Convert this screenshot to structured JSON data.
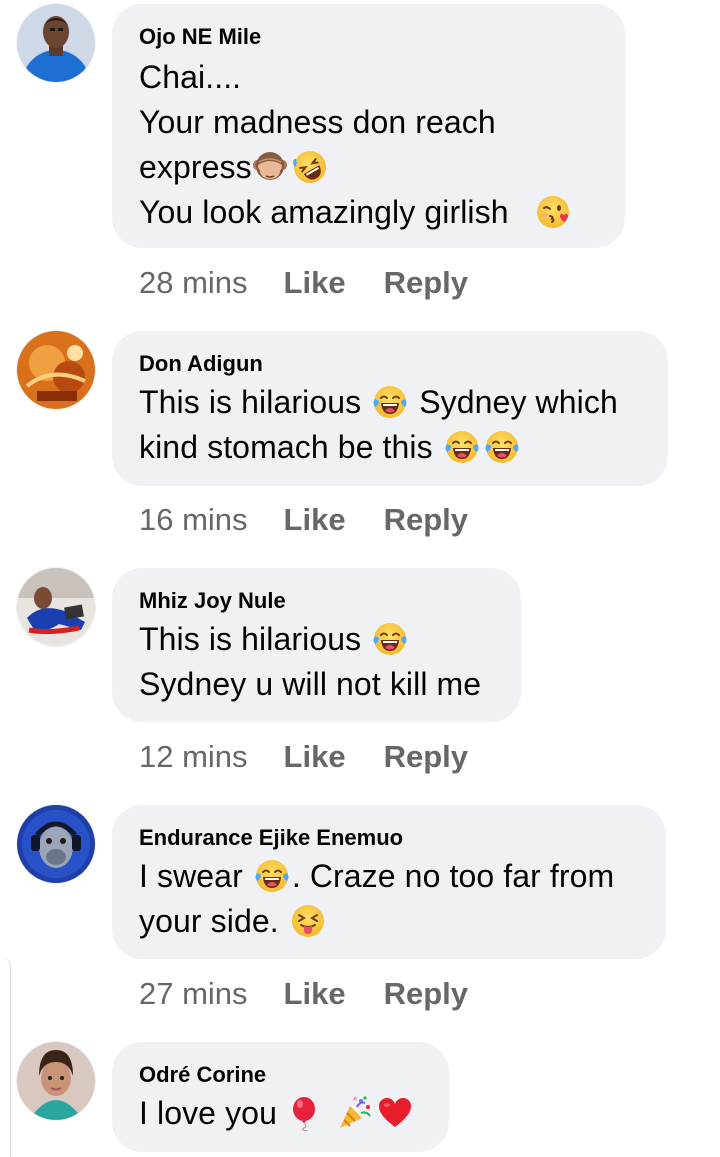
{
  "comments": [
    {
      "author": "Ojo NE Mile",
      "lines": [
        "Chai....",
        "Your madness don reach",
        "express",
        "You look amazingly girlish"
      ],
      "time": "28 mins",
      "like": "Like",
      "reply": "Reply"
    },
    {
      "author": "Don Adigun",
      "lines": [
        "This is hilarious",
        "Sydney which",
        "kind stomach be this"
      ],
      "time": "16 mins",
      "like": "Like",
      "reply": "Reply"
    },
    {
      "author": "Mhiz Joy Nule",
      "lines": [
        "This is hilarious",
        "Sydney u will not kill me"
      ],
      "time": "12 mins",
      "like": "Like",
      "reply": "Reply"
    },
    {
      "author": "Endurance Ejike Enemuo",
      "lines": [
        "I swear",
        ". Craze no too far from",
        "your side."
      ],
      "time": "27 mins",
      "like": "Like",
      "reply": "Reply"
    },
    {
      "author": "Odré Corine",
      "lines": [
        "I love you"
      ]
    }
  ],
  "icons": {
    "see_no_evil_monkey": "see-no-evil-monkey-icon",
    "rofl": "rolling-on-floor-laughing-icon",
    "kiss_wink": "face-blowing-kiss-icon",
    "joy": "face-with-tears-of-joy-icon",
    "squint_tongue": "squinting-face-with-tongue-icon",
    "balloon": "balloon-icon",
    "party_popper": "party-popper-icon",
    "heart": "red-heart-icon"
  },
  "colors": {
    "bubble": "#eff1f4",
    "meta_text": "#65676b",
    "text": "#050505"
  }
}
